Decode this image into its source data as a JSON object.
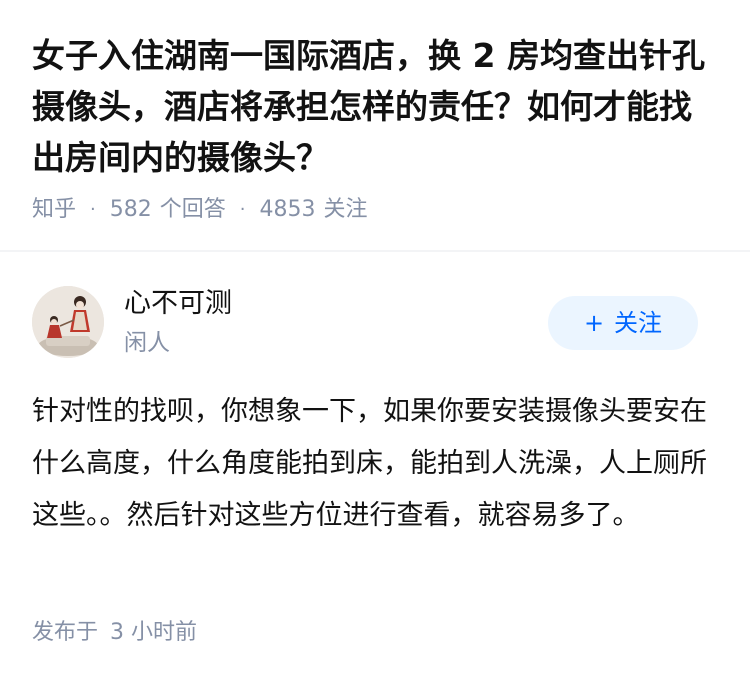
{
  "question": {
    "title": "女子入住湖南一国际酒店，换 2 房均查出针孔摄像头，酒店将承担怎样的责任？如何才能找出房间内的摄像头？",
    "source": "知乎",
    "answer_count": "582",
    "answer_label": "个回答",
    "follower_count": "4853",
    "follower_label": "关注"
  },
  "answer": {
    "author_name": "心不可测",
    "author_bio": "闲人",
    "follow_plus": "+",
    "follow_label": "关注",
    "content": "针对性的找呗，你想象一下，如果你要安装摄像头要安在什么高度，什么角度能拍到床，能拍到人洗澡，人上厕所这些。。然后针对这些方位进行查看，就容易多了。",
    "published_label": "发布于",
    "published_time": "3 小时前"
  },
  "colors": {
    "text": "#121212",
    "meta": "#8590a6",
    "accent": "#0066ff",
    "button_bg": "#ebf5ff"
  },
  "icons": {
    "avatar": "avatar-doll-figure"
  }
}
